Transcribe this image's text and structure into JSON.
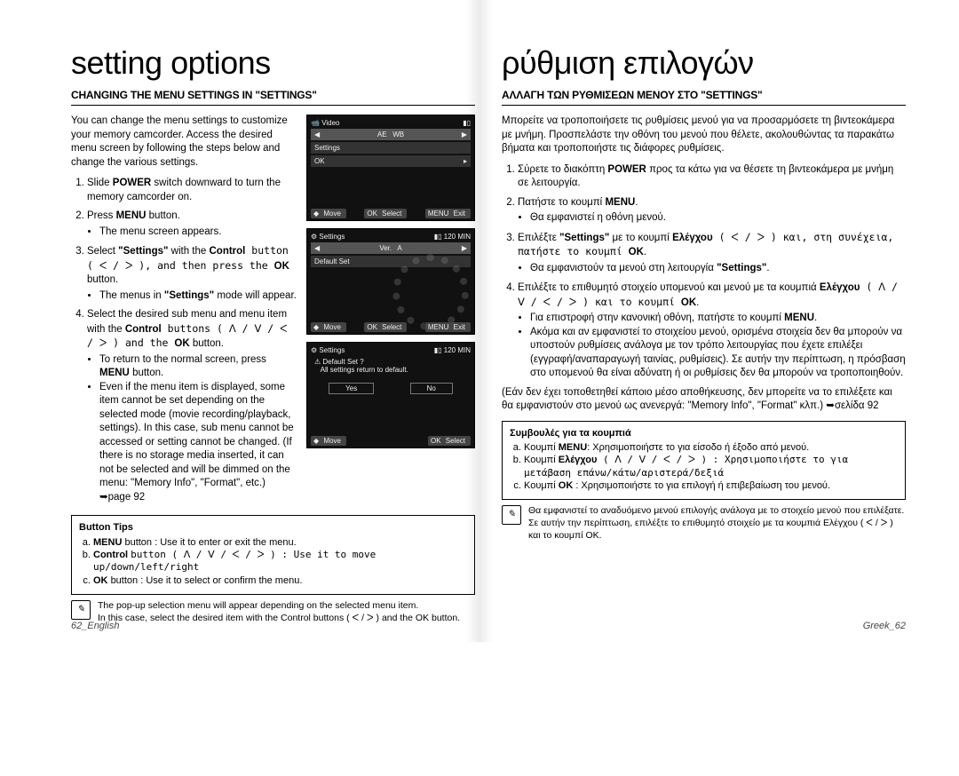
{
  "left": {
    "title": "setting options",
    "subtitle": "CHANGING THE MENU SETTINGS IN \"SETTINGS\"",
    "intro": "You can change the menu settings to customize your memory camcorder. Access the desired menu screen by following the steps below and change the various settings.",
    "s1a": "Slide ",
    "s1b": "POWER",
    "s1c": " switch downward to turn the memory camcorder on.",
    "s2a": "Press ",
    "s2b": "MENU",
    "s2c": " button.",
    "s2bullet": "The menu screen appears.",
    "s3a": "Select ",
    "s3b": "\"Settings\"",
    "s3c": " with the ",
    "s3d": "Control",
    "s3e": " button ( ᐸ / ᐳ ), and then press the ",
    "s3f": "OK",
    "s3g": " button.",
    "s3bullet": "The menus in \"Settings\" mode will appear.",
    "s4a": "Select the desired sub menu and menu item with the ",
    "s4b": "Control",
    "s4c": " buttons ( ᐱ / ᐯ / ᐸ / ᐳ ) and the ",
    "s4d": "OK",
    "s4e": " button.",
    "s4b1a": "To return to the normal screen, press ",
    "s4b1b": "MENU",
    "s4b1c": " button.",
    "s4b2": "Even if the menu item is displayed, some item cannot be set depending on the selected mode (movie recording/playback, settings). In this case, sub menu cannot be accessed or setting cannot be changed. (If there is no storage media inserted, it can not be selected and will be dimmed on the menu: \"Memory Info\", \"Format\", etc.) ➥page 92",
    "tips_title": "Button Tips",
    "tips_a": "MENU button : Use it to enter or exit the menu.",
    "tips_b": "Control button ( ᐱ / ᐯ / ᐸ / ᐳ ) : Use it to move up/down/left/right",
    "tips_c": "OK button : Use it to select or confirm the menu.",
    "note1": "The pop-up selection menu will appear depending on the selected menu item.",
    "note2": "In this case, select the desired item with the Control buttons ( ᐸ / ᐳ ) and the OK button.",
    "foot": "62_English"
  },
  "right": {
    "title": "ρύθμιση επιλογών",
    "subtitle": "ΑΛΛΑΓΗ ΤΩΝ ΡΥΘΜΙΣΕΩΝ ΜΕΝΟΥ ΣΤΟ \"SETTINGS\"",
    "intro": "Μπορείτε να τροποποιήσετε τις ρυθμίσεις μενού για να προσαρμόσετε τη βιντεοκάμερα με μνήμη. Προσπελάστε την οθόνη του μενού που θέλετε, ακολουθώντας τα παρακάτω βήματα και τροποποιήστε τις διάφορες ρυθμίσεις.",
    "s1": "Σύρετε το διακόπτη POWER προς τα κάτω για να θέσετε τη βιντεοκάμερα με μνήμη σε λειτουργία.",
    "s2a": "Πατήστε το κουμπί ",
    "s2b": "MENU",
    "s2c": ".",
    "s2bullet": "Θα εμφανιστεί η οθόνη μενού.",
    "s3a": "Επιλέξτε ",
    "s3b": "\"Settings\"",
    "s3c": " με το κουμπί ",
    "s3d": "Ελέγχου",
    "s3e": " ( ᐸ / ᐳ ) και, στη συνέχεια, πατήστε το κουμπί ",
    "s3f": "OK",
    "s3g": ".",
    "s3bullet": "Θα εμφανιστούν τα μενού στη λειτουργία \"Settings\".",
    "s4a": "Επιλέξτε το επιθυμητό στοιχείο υπομενού και μενού με τα κουμπιά ",
    "s4b": "Ελέγχου",
    "s4c": " ( ᐱ / ᐯ / ᐸ / ᐳ ) και το κουμπί ",
    "s4d": "OK",
    "s4e": ".",
    "s4b1a": "Για επιστροφή στην κανονική οθόνη, πατήστε το κουμπί ",
    "s4b1b": "MENU",
    "s4b1c": ".",
    "s4b2": "Ακόμα και αν εμφανιστεί το στοιχείου μενού, ορισμένα στοιχεία δεν θα μπορούν να υποστούν ρυθμίσεις ανάλογα με τον τρόπο λειτουργίας που έχετε επιλέξει (εγγραφή/αναπαραγωγή ταινίας, ρυθμίσεις). Σε αυτήν την περίπτωση, η πρόσβαση στο υπομενού θα είναι αδύνατη ή οι ρυθμίσεις δεν θα μπορούν να τροποποιηθούν.",
    "tail": "(Εάν δεν έχει τοποθετηθεί κάποιο μέσο αποθήκευσης, δεν μπορείτε να το επιλέξετε και θα εμφανιστούν στο μενού ως ανενεργά: \"Memory Info\", \"Format\" κλπ.) ➥σελίδα 92",
    "tips_title": "Συμβουλές για τα κουμπιά",
    "tips_a": "Κουμπί MENU: Χρησιμοποιήστε το για είσοδο ή έξοδο από μενού.",
    "tips_b": "Κουμπί Ελέγχου ( ᐱ / ᐯ / ᐸ / ᐳ ) : Χρησιμοποιήστε το για μετάβαση επάνω/κάτω/αριστερά/δεξιά",
    "tips_c": "Κουμπί OK : Χρησιμοποιήστε το για επιλογή ή επιβεβαίωση του μενού.",
    "note1": "Θα εμφανιστεί το αναδυόμενο μενού επιλογής ανάλογα με το στοιχείο μενού που επιλέξατε.",
    "note2": "Σε αυτήν την περίπτωση, επιλέξτε το επιθυμητό στοιχείο με τα κουμπιά Ελέγχου ( ᐸ / ᐳ ) και το κουμπί OK.",
    "foot": "Greek_62"
  },
  "screens": {
    "video": "Video",
    "settings": "Settings",
    "ok": "OK",
    "move": "Move",
    "select": "Select",
    "exit": "Exit",
    "menu": "MENU",
    "default_set": "Default Set",
    "default_q": "Default Set ?",
    "default_msg": "All settings return to default.",
    "yes": "Yes",
    "no": "No",
    "min": "120 MIN",
    "ver": "Ver."
  }
}
